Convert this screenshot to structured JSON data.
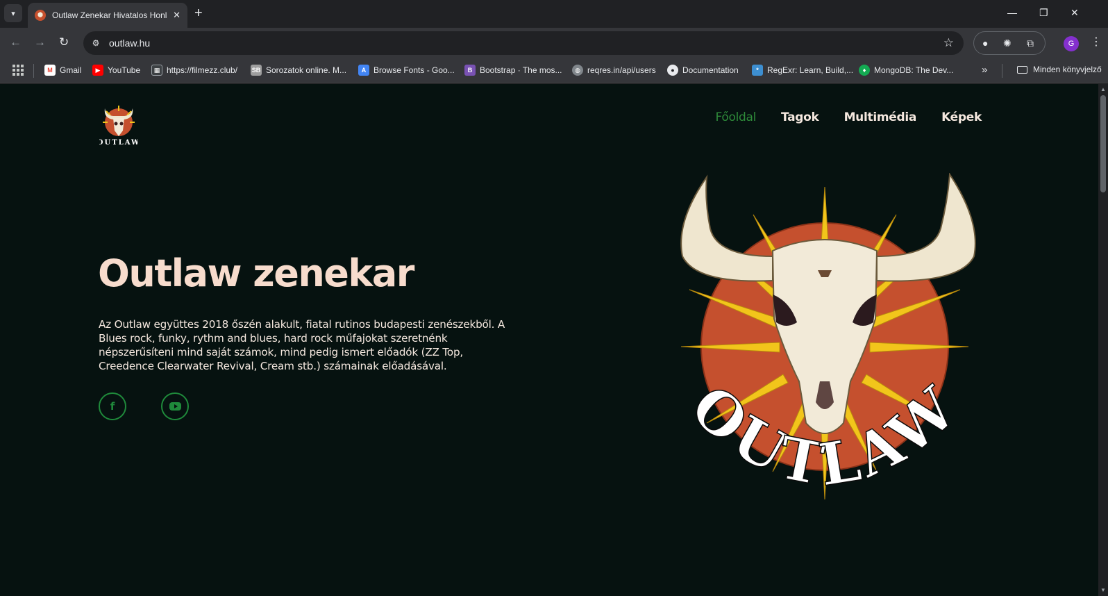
{
  "browser": {
    "tab_title": "Outlaw Zenekar Hivatalos Honlapja",
    "new_tab_symbol": "+",
    "tab_close_symbol": "✕",
    "url": "outlaw.hu",
    "profile_initial": "G",
    "bookmarks": [
      {
        "label": "Gmail",
        "icon": "gmail-icon",
        "color": "#ea4335"
      },
      {
        "label": "YouTube",
        "icon": "youtube-icon",
        "color": "#ff0000"
      },
      {
        "label": "https://filmezz.club/",
        "icon": "film-icon",
        "color": "#5f6368"
      },
      {
        "label": "Sorozatok online. M...",
        "icon": "sb-icon",
        "color": "#9e9e9e"
      },
      {
        "label": "Browse Fonts - Goo...",
        "icon": "google-fonts-icon",
        "color": "#4285f4"
      },
      {
        "label": "Bootstrap · The mos...",
        "icon": "bootstrap-icon",
        "color": "#7952b3"
      },
      {
        "label": "reqres.in/api/users",
        "icon": "globe-icon",
        "color": "#80868b"
      },
      {
        "label": "Documentation",
        "icon": "github-icon",
        "color": "#e8eaed"
      },
      {
        "label": "RegExr: Learn, Build,...",
        "icon": "regexr-icon",
        "color": "#3d8fd1"
      },
      {
        "label": "MongoDB: The Dev...",
        "icon": "mongodb-icon",
        "color": "#13aa52"
      }
    ],
    "all_bookmarks_label": "Minden könyvjelző"
  },
  "page": {
    "nav": [
      {
        "label": "Főoldal",
        "active": true
      },
      {
        "label": "Tagok",
        "active": false
      },
      {
        "label": "Multimédia",
        "active": false
      },
      {
        "label": "Képek",
        "active": false
      }
    ],
    "hero": {
      "title": "Outlaw zenekar",
      "text": "Az Outlaw együttes 2018 őszén alakult, fiatal rutinos budapesti zenészekből. A Blues rock, funky, rythm and blues, hard rock műfajokat szeretnénk népszerűsíteni mind saját számok, mind pedig ismert előadók (ZZ Top, Creedence Clearwater Revival, Cream stb.) számainak előadásával."
    },
    "social": [
      {
        "name": "facebook",
        "icon": "facebook-icon"
      },
      {
        "name": "youtube",
        "icon": "youtube-icon"
      }
    ],
    "logo_text": "OUTLAW",
    "colors": {
      "background": "#061210",
      "accent_green": "#1f8a3b",
      "title": "#f7dccd",
      "sun_red": "#c5502e",
      "ray_yellow": "#f2c51b"
    }
  }
}
